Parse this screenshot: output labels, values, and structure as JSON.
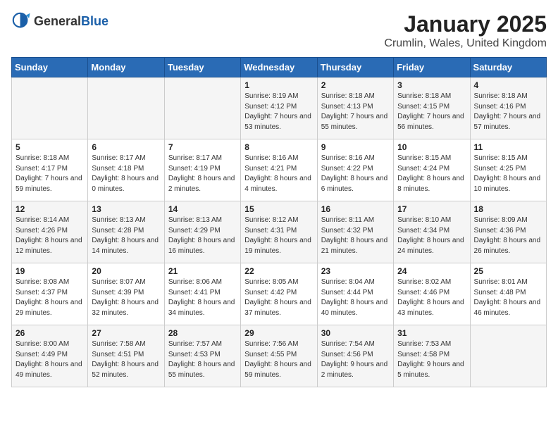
{
  "header": {
    "logo_general": "General",
    "logo_blue": "Blue",
    "title": "January 2025",
    "subtitle": "Crumlin, Wales, United Kingdom"
  },
  "days_of_week": [
    "Sunday",
    "Monday",
    "Tuesday",
    "Wednesday",
    "Thursday",
    "Friday",
    "Saturday"
  ],
  "weeks": [
    [
      {
        "day": "",
        "info": ""
      },
      {
        "day": "",
        "info": ""
      },
      {
        "day": "",
        "info": ""
      },
      {
        "day": "1",
        "info": "Sunrise: 8:19 AM\nSunset: 4:12 PM\nDaylight: 7 hours and 53 minutes."
      },
      {
        "day": "2",
        "info": "Sunrise: 8:18 AM\nSunset: 4:13 PM\nDaylight: 7 hours and 55 minutes."
      },
      {
        "day": "3",
        "info": "Sunrise: 8:18 AM\nSunset: 4:15 PM\nDaylight: 7 hours and 56 minutes."
      },
      {
        "day": "4",
        "info": "Sunrise: 8:18 AM\nSunset: 4:16 PM\nDaylight: 7 hours and 57 minutes."
      }
    ],
    [
      {
        "day": "5",
        "info": "Sunrise: 8:18 AM\nSunset: 4:17 PM\nDaylight: 7 hours and 59 minutes."
      },
      {
        "day": "6",
        "info": "Sunrise: 8:17 AM\nSunset: 4:18 PM\nDaylight: 8 hours and 0 minutes."
      },
      {
        "day": "7",
        "info": "Sunrise: 8:17 AM\nSunset: 4:19 PM\nDaylight: 8 hours and 2 minutes."
      },
      {
        "day": "8",
        "info": "Sunrise: 8:16 AM\nSunset: 4:21 PM\nDaylight: 8 hours and 4 minutes."
      },
      {
        "day": "9",
        "info": "Sunrise: 8:16 AM\nSunset: 4:22 PM\nDaylight: 8 hours and 6 minutes."
      },
      {
        "day": "10",
        "info": "Sunrise: 8:15 AM\nSunset: 4:24 PM\nDaylight: 8 hours and 8 minutes."
      },
      {
        "day": "11",
        "info": "Sunrise: 8:15 AM\nSunset: 4:25 PM\nDaylight: 8 hours and 10 minutes."
      }
    ],
    [
      {
        "day": "12",
        "info": "Sunrise: 8:14 AM\nSunset: 4:26 PM\nDaylight: 8 hours and 12 minutes."
      },
      {
        "day": "13",
        "info": "Sunrise: 8:13 AM\nSunset: 4:28 PM\nDaylight: 8 hours and 14 minutes."
      },
      {
        "day": "14",
        "info": "Sunrise: 8:13 AM\nSunset: 4:29 PM\nDaylight: 8 hours and 16 minutes."
      },
      {
        "day": "15",
        "info": "Sunrise: 8:12 AM\nSunset: 4:31 PM\nDaylight: 8 hours and 19 minutes."
      },
      {
        "day": "16",
        "info": "Sunrise: 8:11 AM\nSunset: 4:32 PM\nDaylight: 8 hours and 21 minutes."
      },
      {
        "day": "17",
        "info": "Sunrise: 8:10 AM\nSunset: 4:34 PM\nDaylight: 8 hours and 24 minutes."
      },
      {
        "day": "18",
        "info": "Sunrise: 8:09 AM\nSunset: 4:36 PM\nDaylight: 8 hours and 26 minutes."
      }
    ],
    [
      {
        "day": "19",
        "info": "Sunrise: 8:08 AM\nSunset: 4:37 PM\nDaylight: 8 hours and 29 minutes."
      },
      {
        "day": "20",
        "info": "Sunrise: 8:07 AM\nSunset: 4:39 PM\nDaylight: 8 hours and 32 minutes."
      },
      {
        "day": "21",
        "info": "Sunrise: 8:06 AM\nSunset: 4:41 PM\nDaylight: 8 hours and 34 minutes."
      },
      {
        "day": "22",
        "info": "Sunrise: 8:05 AM\nSunset: 4:42 PM\nDaylight: 8 hours and 37 minutes."
      },
      {
        "day": "23",
        "info": "Sunrise: 8:04 AM\nSunset: 4:44 PM\nDaylight: 8 hours and 40 minutes."
      },
      {
        "day": "24",
        "info": "Sunrise: 8:02 AM\nSunset: 4:46 PM\nDaylight: 8 hours and 43 minutes."
      },
      {
        "day": "25",
        "info": "Sunrise: 8:01 AM\nSunset: 4:48 PM\nDaylight: 8 hours and 46 minutes."
      }
    ],
    [
      {
        "day": "26",
        "info": "Sunrise: 8:00 AM\nSunset: 4:49 PM\nDaylight: 8 hours and 49 minutes."
      },
      {
        "day": "27",
        "info": "Sunrise: 7:58 AM\nSunset: 4:51 PM\nDaylight: 8 hours and 52 minutes."
      },
      {
        "day": "28",
        "info": "Sunrise: 7:57 AM\nSunset: 4:53 PM\nDaylight: 8 hours and 55 minutes."
      },
      {
        "day": "29",
        "info": "Sunrise: 7:56 AM\nSunset: 4:55 PM\nDaylight: 8 hours and 59 minutes."
      },
      {
        "day": "30",
        "info": "Sunrise: 7:54 AM\nSunset: 4:56 PM\nDaylight: 9 hours and 2 minutes."
      },
      {
        "day": "31",
        "info": "Sunrise: 7:53 AM\nSunset: 4:58 PM\nDaylight: 9 hours and 5 minutes."
      },
      {
        "day": "",
        "info": ""
      }
    ]
  ]
}
